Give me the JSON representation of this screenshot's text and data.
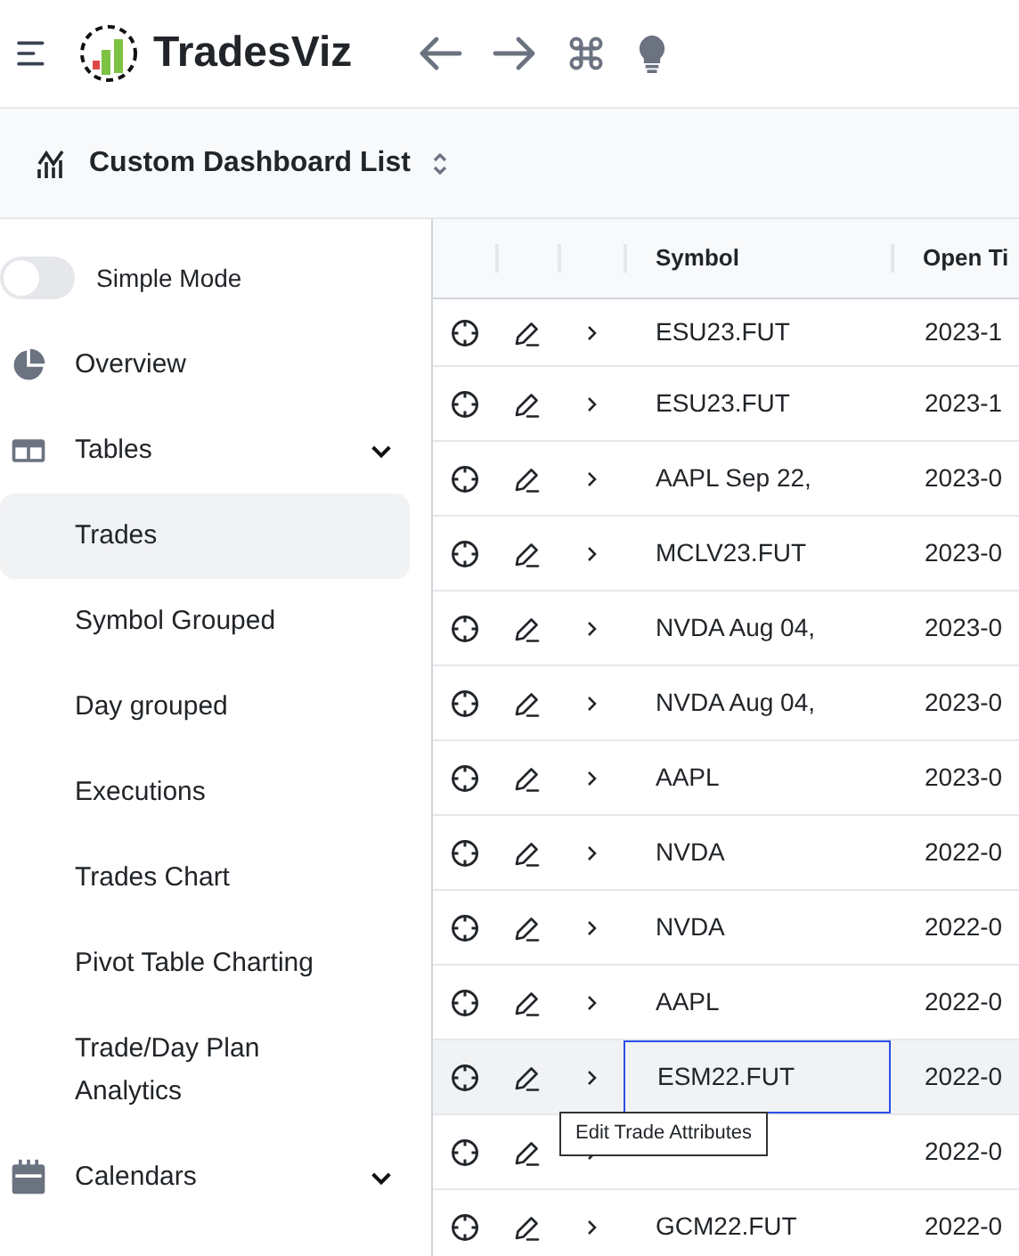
{
  "header": {
    "brand": "TradesViz"
  },
  "subheader": {
    "title": "Custom Dashboard List"
  },
  "sidebar": {
    "simple_mode": {
      "label": "Simple Mode",
      "on": false
    },
    "items": [
      {
        "kind": "section",
        "label": "Overview"
      },
      {
        "kind": "section",
        "label": "Tables",
        "expanded": true,
        "children": [
          {
            "label": "Trades",
            "selected": true
          },
          {
            "label": "Symbol Grouped",
            "selected": false
          },
          {
            "label": "Day grouped",
            "selected": false
          },
          {
            "label": "Executions",
            "selected": false
          },
          {
            "label": "Trades Chart",
            "selected": false
          },
          {
            "label": "Pivot Table Charting",
            "selected": false
          },
          {
            "label": "Trade/Day Plan Analytics",
            "selected": false
          }
        ]
      },
      {
        "kind": "section",
        "label": "Calendars",
        "expanded": true
      }
    ]
  },
  "table": {
    "columns": [
      "Symbol",
      "Open Ti"
    ],
    "rows": [
      {
        "symbol": "ESU23.FUT",
        "open_time": "2023-1",
        "selected": false
      },
      {
        "symbol": "ESU23.FUT",
        "open_time": "2023-1",
        "selected": false
      },
      {
        "symbol": "AAPL Sep 22,",
        "open_time": "2023-0",
        "selected": false
      },
      {
        "symbol": "MCLV23.FUT",
        "open_time": "2023-0",
        "selected": false
      },
      {
        "symbol": "NVDA Aug 04,",
        "open_time": "2023-0",
        "selected": false
      },
      {
        "symbol": "NVDA Aug 04,",
        "open_time": "2023-0",
        "selected": false
      },
      {
        "symbol": "AAPL",
        "open_time": "2023-0",
        "selected": false
      },
      {
        "symbol": "NVDA",
        "open_time": "2022-0",
        "selected": false
      },
      {
        "symbol": "NVDA",
        "open_time": "2022-0",
        "selected": false
      },
      {
        "symbol": "AAPL",
        "open_time": "2022-0",
        "selected": false
      },
      {
        "symbol": "ESM22.FUT",
        "open_time": "2022-0",
        "selected": true,
        "tooltip": "Edit Trade Attributes"
      },
      {
        "open_time": "2022-0",
        "selected": false
      },
      {
        "symbol": "GCM22.FUT",
        "open_time": "2022-0",
        "selected": false
      }
    ]
  }
}
